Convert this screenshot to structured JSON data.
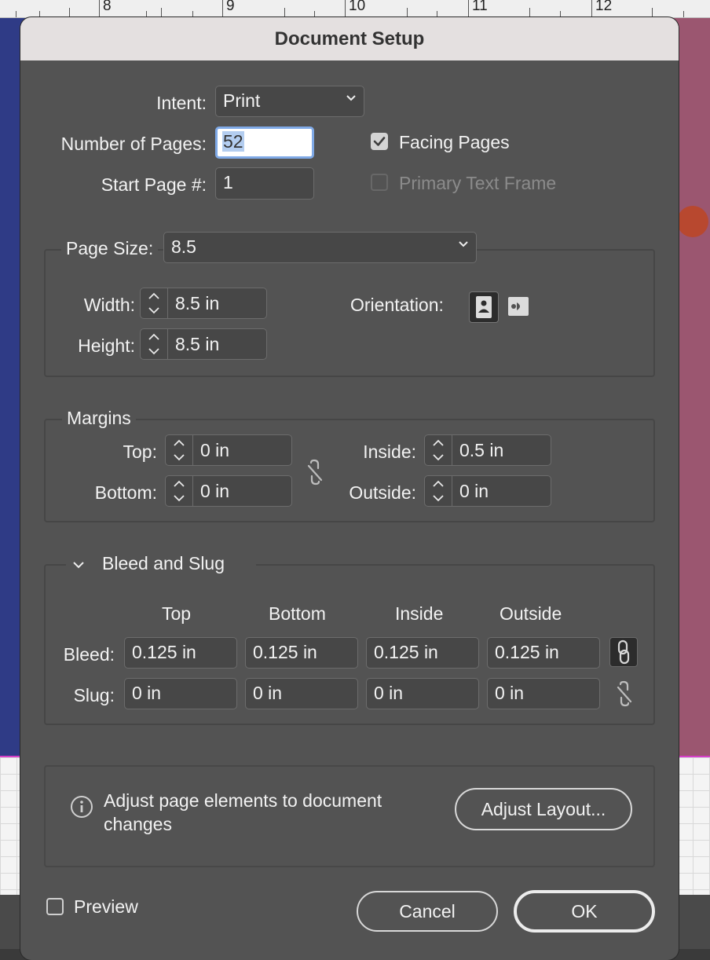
{
  "ruler": {
    "numbers": [
      "8",
      "9",
      "10",
      "11",
      "12"
    ]
  },
  "dialog": {
    "title": "Document Setup",
    "intent": {
      "label": "Intent:",
      "value": "Print"
    },
    "pages": {
      "label": "Number of Pages:",
      "value": "52"
    },
    "start_page": {
      "label": "Start Page #:",
      "value": "1"
    },
    "facing_pages": {
      "label": "Facing Pages",
      "checked": true
    },
    "primary_text_frame": {
      "label": "Primary Text Frame",
      "checked": false,
      "enabled": false
    },
    "page_size": {
      "label": "Page Size:",
      "value": "8.5",
      "width_label": "Width:",
      "width": "8.5 in",
      "height_label": "Height:",
      "height": "8.5 in",
      "orientation_label": "Orientation:",
      "orientation": "portrait"
    },
    "margins": {
      "title": "Margins",
      "top_label": "Top:",
      "top": "0 in",
      "bottom_label": "Bottom:",
      "bottom": "0 in",
      "inside_label": "Inside:",
      "inside": "0.5 in",
      "outside_label": "Outside:",
      "outside": "0 in",
      "linked": false
    },
    "bleed_slug": {
      "title": "Bleed and Slug",
      "columns": [
        "Top",
        "Bottom",
        "Inside",
        "Outside"
      ],
      "bleed_label": "Bleed:",
      "bleed": [
        "0.125 in",
        "0.125 in",
        "0.125 in",
        "0.125 in"
      ],
      "bleed_linked": true,
      "slug_label": "Slug:",
      "slug": [
        "0 in",
        "0 in",
        "0 in",
        "0 in"
      ],
      "slug_linked": false
    },
    "adjust": {
      "text_line1": "Adjust page elements to document",
      "text_line2": "changes",
      "button": "Adjust Layout..."
    },
    "preview": {
      "label": "Preview",
      "checked": false
    },
    "cancel": "Cancel",
    "ok": "OK"
  }
}
